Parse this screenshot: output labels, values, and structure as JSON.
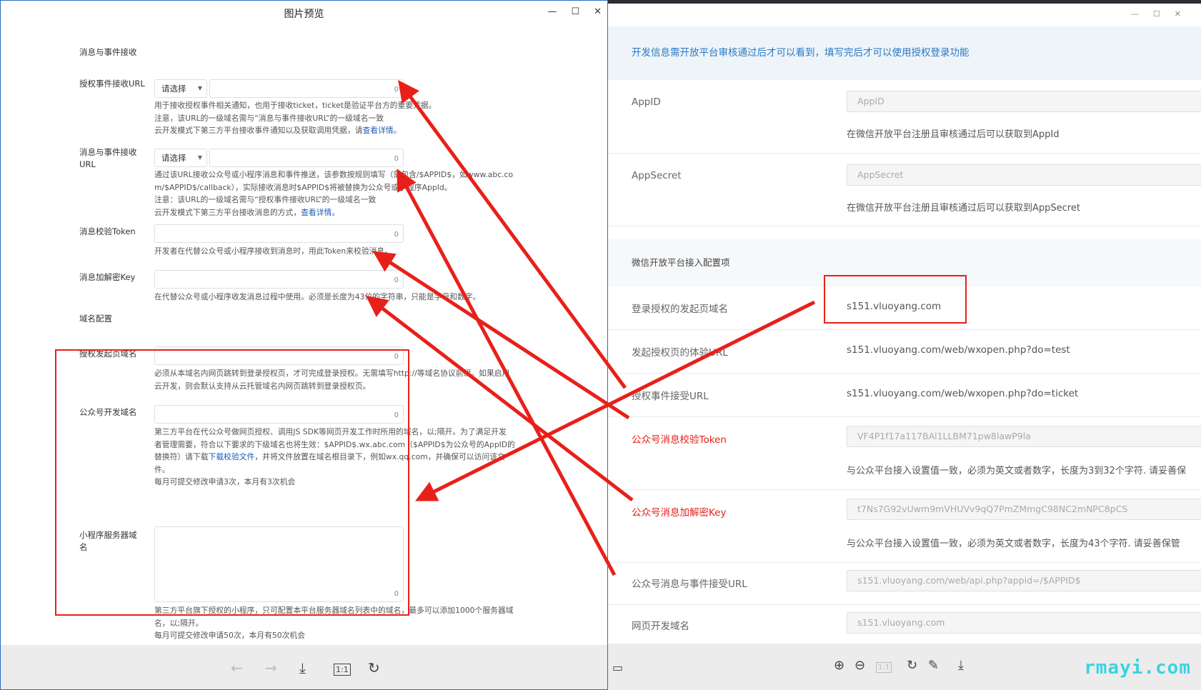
{
  "left_window": {
    "title": "图片预览",
    "section_message": "消息与事件接收",
    "field_auth_event_url": {
      "label": "授权事件接收URL",
      "select": "请选择",
      "count": "0",
      "help_line1": "用于接收授权事件相关通知，也用于接收ticket，ticket是验证平台方的重要凭据。",
      "help_line2": "注意，该URL的一级域名需与“消息与事件接收URL”的一级域名一致",
      "help_line3": "云开发模式下第三方平台接收事件通知以及获取调用凭据，请",
      "help_link": "查看详情。"
    },
    "field_msg_event_url": {
      "label": "消息与事件接收URL",
      "select": "请选择",
      "count": "0",
      "help_line1": "通过该URL接收公众号或小程序消息和事件推送，该参数按规则填写（需包含/$APPID$，如www.abc.co",
      "help_line2": "m/$APPID$/callback），实际接收消息时$APPID$将被替换为公众号或小程序AppId。",
      "help_line3": "注意：该URL的一级域名需与“授权事件接收URL”的一级域名一致",
      "help_line4": "云开发模式下第三方平台接收消息的方式，",
      "help_link": "查看详情。"
    },
    "field_token": {
      "label": "消息校验Token",
      "count": "0",
      "help": "开发者在代替公众号或小程序接收到消息时，用此Token来校验消息。"
    },
    "field_key": {
      "label": "消息加解密Key",
      "count": "0",
      "help": "在代替公众号或小程序收发消息过程中使用。必须是长度为43位的字符串，只能是字母和数字。"
    },
    "section_domain": "域名配置",
    "field_login_domain": {
      "label": "授权发起页域名",
      "count": "0",
      "help_line1": "必须从本域名内网页跳转到登录授权页，才可完成登录授权。无需填写http://等域名协议前缀。如果启用",
      "help_line2": "云开发，则会默认支持从云托管域名内网页跳转到登录授权页。"
    },
    "field_mp_domain": {
      "label": "公众号开发域名",
      "count": "0",
      "help_line1": "第三方平台在代公众号做网页授权、调用JS SDK等网页开发工作时所用的域名，以;隔开。为了满足开发",
      "help_line2": "者管理需要，符合以下要求的下级域名也将生效：$APPID$.wx.abc.com（$APPID$为公众号的AppID的",
      "help_line3_pre": "替换符）请下载",
      "help_link": "下载校验文件",
      "help_line3_post": "，并将文件放置在域名根目录下，例如wx.qq.com，并确保可以访问该文",
      "help_line4": "件。",
      "help_line5": "每月可提交修改申请3次，本月有3次机会"
    },
    "field_miniapp_domain": {
      "label": "小程序服务器域名",
      "count": "0",
      "help_line1": "第三方平台旗下授权的小程序，只可配置本平台服务器域名列表中的域名，最多可以添加1000个服务器域",
      "help_line2": "名，以;隔开。",
      "help_line3": "每月可提交修改申请50次，本月有50次机会"
    },
    "toolbar": {
      "prev_icon": "←",
      "next_icon": "→",
      "download_icon": "⤓",
      "actual_size": "1:1",
      "rotate_icon": "↻"
    }
  },
  "right_window": {
    "notice": "开发信息需开放平台审核通过后才可以看到，填写完后才可以使用授权登录功能",
    "appid": {
      "label": "AppID",
      "placeholder": "AppID",
      "help": "在微信开放平台注册且审核通过后可以获取到AppId"
    },
    "appsecret": {
      "label": "AppSecret",
      "placeholder": "AppSecret",
      "help": "在微信开放平台注册且审核通过后可以获取到AppSecret"
    },
    "section": "微信开放平台接入配置项",
    "rows": {
      "login_domain": {
        "label": "登录授权的发起页域名",
        "value": "s151.vluoyang.com"
      },
      "test_url": {
        "label": "发起授权页的体验URL",
        "value": "s151.vluoyang.com/web/wxopen.php?do=test"
      },
      "ticket_url": {
        "label": "授权事件接受URL",
        "value": "s151.vluoyang.com/web/wxopen.php?do=ticket"
      },
      "token": {
        "label": "公众号消息校验Token",
        "value": "VF4P1f17a117BAl1LLBM71pw8lawP9la",
        "help": "与公众平台接入设置值一致，必须为英文或者数字，长度为3到32个字符. 请妥善保"
      },
      "aeskey": {
        "label": "公众号消息加解密Key",
        "value": "t7Ns7G92vUwm9mVHUVv9qQ7PmZMmgC98NC2mNPC8pCS",
        "help": "与公众平台接入设置值一致，必须为英文或者数字，长度为43个字符. 请妥善保管"
      },
      "msg_url": {
        "label": "公众号消息与事件接受URL",
        "value": "s151.vluoyang.com/web/api.php?appid=/$APPID$"
      },
      "web_domain": {
        "label": "网页开发域名",
        "value": "s151.vluoyang.com"
      }
    },
    "toolbar": {
      "zoom_in": "⊕",
      "zoom_out": "⊖",
      "actual_size": "1:1",
      "rotate": "↻",
      "edit": "✎",
      "download": "⤓"
    }
  },
  "watermark": "rmayi.com",
  "annotation_color": "#e8201a"
}
